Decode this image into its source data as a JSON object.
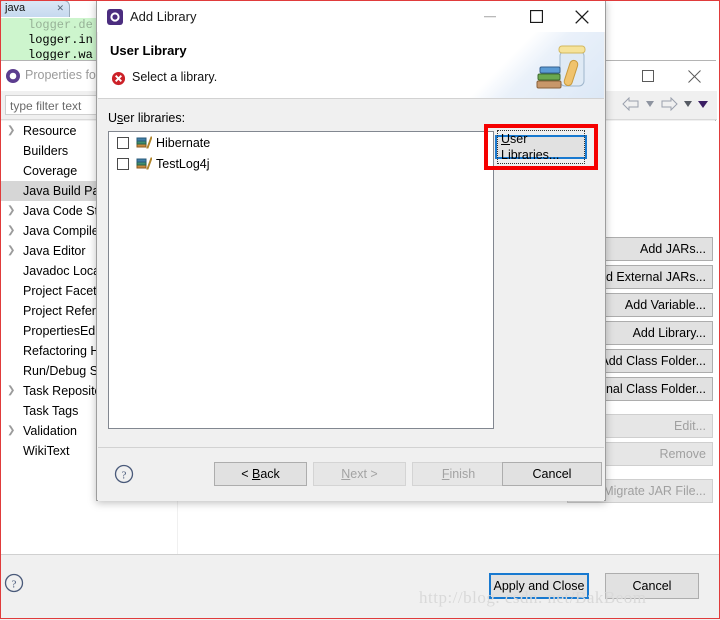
{
  "editor": {
    "tab_label": "java",
    "tab_close_icon": "close-icon",
    "code_lines": [
      "logger.in",
      "logger.wa"
    ]
  },
  "properties_dialog": {
    "icon": "eclipse-icon",
    "title": "Properties for",
    "window_buttons": {
      "maximize": "maximize-icon",
      "close": "close-icon"
    },
    "toolbar": {
      "back_icon": "back-arrow-icon",
      "back_caret": "chevron-down-icon",
      "forward_icon": "forward-arrow-icon",
      "forward_caret": "chevron-down-icon",
      "menu_caret": "chevron-down-icon"
    },
    "filter_placeholder": "type filter text",
    "tree_items": [
      {
        "label": "Resource",
        "expandable": true,
        "selected": false
      },
      {
        "label": "Builders",
        "expandable": false,
        "selected": false
      },
      {
        "label": "Coverage",
        "expandable": false,
        "selected": false
      },
      {
        "label": "Java Build Path",
        "expandable": false,
        "selected": true
      },
      {
        "label": "Java Code Style",
        "expandable": true,
        "selected": false
      },
      {
        "label": "Java Compiler",
        "expandable": true,
        "selected": false
      },
      {
        "label": "Java Editor",
        "expandable": true,
        "selected": false
      },
      {
        "label": "Javadoc Location",
        "expandable": false,
        "selected": false
      },
      {
        "label": "Project Facets",
        "expandable": false,
        "selected": false
      },
      {
        "label": "Project References",
        "expandable": false,
        "selected": false
      },
      {
        "label": "PropertiesEditor",
        "expandable": false,
        "selected": false
      },
      {
        "label": "Refactoring History",
        "expandable": false,
        "selected": false
      },
      {
        "label": "Run/Debug Settings",
        "expandable": false,
        "selected": false
      },
      {
        "label": "Task Repository",
        "expandable": true,
        "selected": false
      },
      {
        "label": "Task Tags",
        "expandable": false,
        "selected": false
      },
      {
        "label": "Validation",
        "expandable": true,
        "selected": false
      },
      {
        "label": "WikiText",
        "expandable": false,
        "selected": false
      }
    ],
    "build_path_buttons": [
      {
        "label": "Add JARs...",
        "disabled": false
      },
      {
        "label": "Add External JARs...",
        "disabled": false
      },
      {
        "label": "Add Variable...",
        "disabled": false
      },
      {
        "label": "Add Library...",
        "disabled": false
      },
      {
        "label": "Add Class Folder...",
        "disabled": false
      },
      {
        "label": "Add External Class Folder...",
        "disabled": false
      },
      {
        "label": "Edit...",
        "disabled": true
      },
      {
        "label": "Remove",
        "disabled": true
      },
      {
        "label": "Migrate JAR File...",
        "disabled": true
      }
    ],
    "apply_label": "Apply",
    "help_icon": "help-icon",
    "apply_and_close_label": "Apply and Close",
    "cancel_label": "Cancel"
  },
  "add_library_dialog": {
    "icon": "eclipse-icon",
    "title": "Add Library",
    "window_buttons": {
      "minimize": "minimize-icon",
      "maximize": "maximize-icon",
      "close": "close-icon"
    },
    "heading": "User Library",
    "message": "Select a library.",
    "message_icon": "error-icon",
    "banner_icon": "library-jar-icon",
    "list_label_prefix": "U",
    "list_label_accel": "s",
    "list_label_suffix": "er libraries:",
    "libraries": [
      {
        "name": "Hibernate",
        "checked": false,
        "icon": "library-books-icon"
      },
      {
        "name": "TestLog4j",
        "checked": false,
        "icon": "library-books-icon"
      }
    ],
    "user_libraries_button": {
      "prefix": "",
      "accel": "U",
      "suffix": "ser Libraries..."
    },
    "help_icon": "help-icon",
    "buttons": [
      {
        "name": "back",
        "prefix": "< ",
        "accel": "B",
        "suffix": "ack",
        "disabled": false
      },
      {
        "name": "next",
        "prefix": "",
        "accel": "N",
        "suffix": "ext >",
        "disabled": true
      },
      {
        "name": "finish",
        "prefix": "",
        "accel": "F",
        "suffix": "inish",
        "disabled": true
      },
      {
        "name": "cancel",
        "prefix": "",
        "accel": "",
        "suffix": "Cancel",
        "disabled": false
      }
    ]
  },
  "watermark": "http://blog. csdn. net/BakBeom",
  "colors": {
    "highlight_red": "#f50000",
    "focus_blue": "#1879d0",
    "selection_green": "#cdf5cd",
    "dialog_face": "#f0f0f0"
  }
}
